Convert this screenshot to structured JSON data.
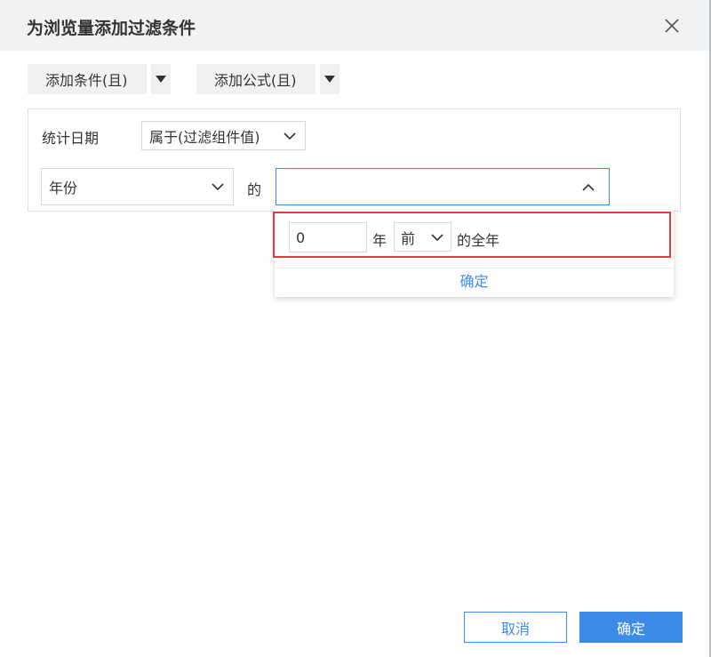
{
  "dialog": {
    "title": "为浏览量添加过滤条件"
  },
  "toolbar": {
    "add_condition_label": "添加条件(且)",
    "add_formula_label": "添加公式(且)"
  },
  "condition": {
    "field_label": "统计日期",
    "operator": "属于(过滤组件值)",
    "unit": "年份",
    "connector": "的",
    "value": ""
  },
  "popup": {
    "number": "0",
    "year_label": "年",
    "direction": "前",
    "suffix": "的全年",
    "confirm_label": "确定"
  },
  "footer": {
    "cancel_label": "取消",
    "ok_label": "确定"
  },
  "colors": {
    "accent": "#3d8be8",
    "highlight": "#e5393d",
    "header_bg": "#f1f2f4"
  }
}
